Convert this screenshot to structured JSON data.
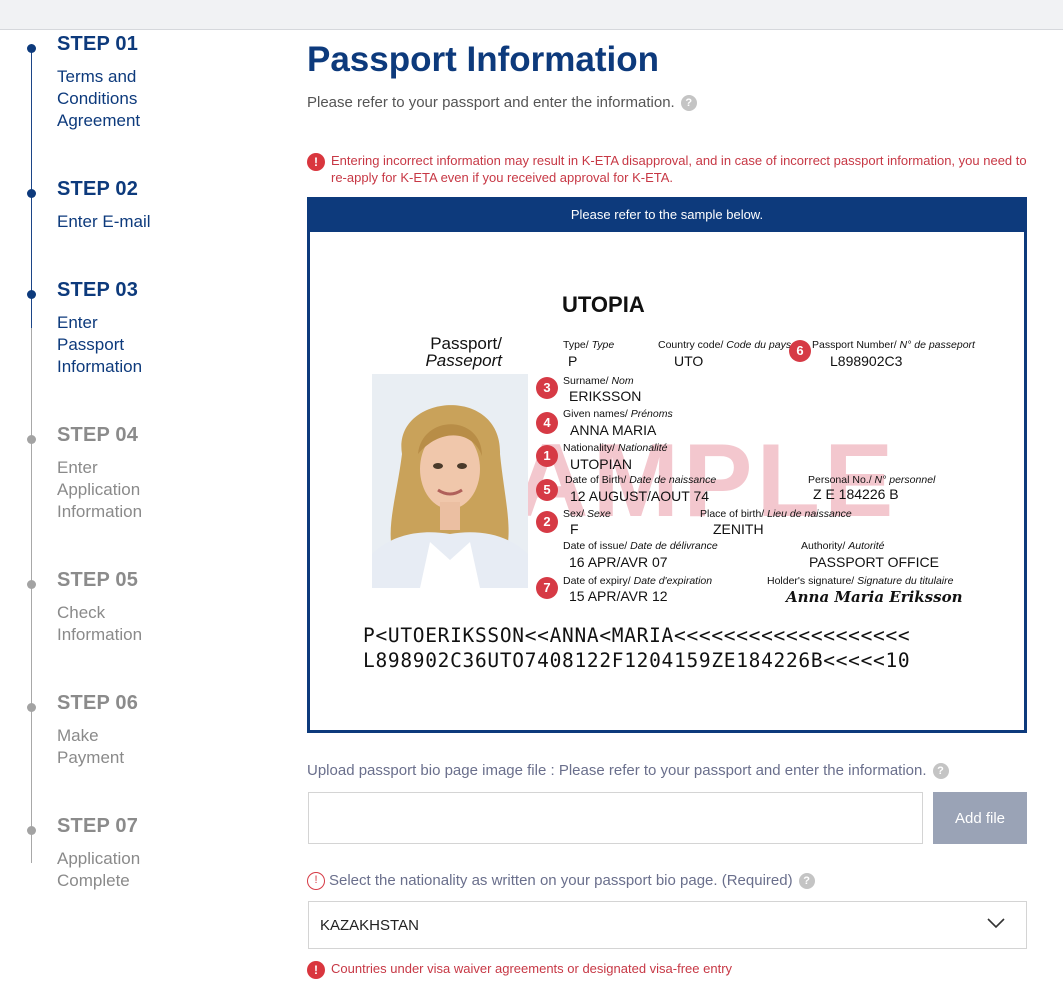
{
  "stepper": {
    "steps": [
      {
        "num": "STEP 01",
        "label": "Terms and Conditions Agreement"
      },
      {
        "num": "STEP 02",
        "label": "Enter E-mail"
      },
      {
        "num": "STEP 03",
        "label": "Enter Passport Information"
      },
      {
        "num": "STEP 04",
        "label": "Enter Application Information"
      },
      {
        "num": "STEP 05",
        "label": "Check Information"
      },
      {
        "num": "STEP 06",
        "label": "Make Payment"
      },
      {
        "num": "STEP 07",
        "label": "Application Complete"
      }
    ],
    "current_step": 3
  },
  "main": {
    "title": "Passport Information",
    "subtitle": "Please refer to your passport and enter the information.",
    "warning": "Entering incorrect information may result in K-ETA disapproval, and in case of incorrect passport information, you need to re-apply for K-ETA even if you received approval for K-ETA.",
    "sample": {
      "header": "Please refer to the sample below.",
      "country": "UTOPIA",
      "doc_title": "Passport/",
      "doc_title_fr": "Passeport",
      "watermark": "SAMPLE",
      "fields": {
        "type": {
          "label": "Type/",
          "label_fr": "Type",
          "value": "P"
        },
        "country_code": {
          "label": "Country code/",
          "label_fr": "Code du pays",
          "value": "UTO"
        },
        "passport_number": {
          "label": "Passport Number/",
          "label_fr": "N° de passeport",
          "value": "L898902C3",
          "badge": "6"
        },
        "surname": {
          "label": "Surname/",
          "label_fr": "Nom",
          "value": "ERIKSSON",
          "badge": "3"
        },
        "given_names": {
          "label": "Given names/",
          "label_fr": "Prénoms",
          "value": "ANNA MARIA",
          "badge": "4"
        },
        "nationality": {
          "label": "Nationality/",
          "label_fr": "Nationalité",
          "value": "UTOPIAN",
          "badge": "1"
        },
        "dob": {
          "label": "Date of Birth/",
          "label_fr": "Date de naissance",
          "value": "12 AUGUST/AOUT 74",
          "badge": "5"
        },
        "personal_no": {
          "label": "Personal No./",
          "label_fr": "N° personnel",
          "value": "Z E 184226 B"
        },
        "sex": {
          "label": "Sex/",
          "label_fr": "Sexe",
          "value": "F",
          "badge": "2"
        },
        "place_of_birth": {
          "label": "Place of birth/",
          "label_fr": "Lieu de naissance",
          "value": "ZENITH"
        },
        "date_of_issue": {
          "label": "Date of issue/",
          "label_fr": "Date de délivrance",
          "value": "16 APR/AVR 07"
        },
        "authority": {
          "label": "Authority/",
          "label_fr": "Autorité",
          "value": "PASSPORT OFFICE"
        },
        "date_of_expiry": {
          "label": "Date of expiry/",
          "label_fr": "Date d'expiration",
          "value": "15 APR/AVR 12",
          "badge": "7"
        },
        "signature": {
          "label": "Holder's signature/",
          "label_fr": "Signature du titulaire",
          "value": "Anna Maria Eriksson"
        }
      },
      "mrz_line1": "P<UTOERIKSSON<<ANNA<MARIA<<<<<<<<<<<<<<<<<<<",
      "mrz_line2": "L898902C36UTO7408122F1204159ZE184226B<<<<<10"
    },
    "upload": {
      "label": "Upload passport bio page image file : Please refer to your passport and enter the information.",
      "file_value": "",
      "button": "Add file"
    },
    "nationality": {
      "required_icon": "!",
      "label": "Select the nationality as written on your passport bio page. (Required)",
      "selected": "KAZAKHSTAN",
      "note": "Countries under visa waiver agreements or designated visa-free entry"
    }
  },
  "icons": {
    "help": "question-circle-icon",
    "warning": "exclamation-circle-icon",
    "dropdown": "chevron-down-icon"
  },
  "colors": {
    "brand_navy": "#0d3a7c",
    "warning_red": "#d63a45",
    "inactive_gray": "#8b8b8b",
    "button_gray": "#9aa3b6"
  }
}
